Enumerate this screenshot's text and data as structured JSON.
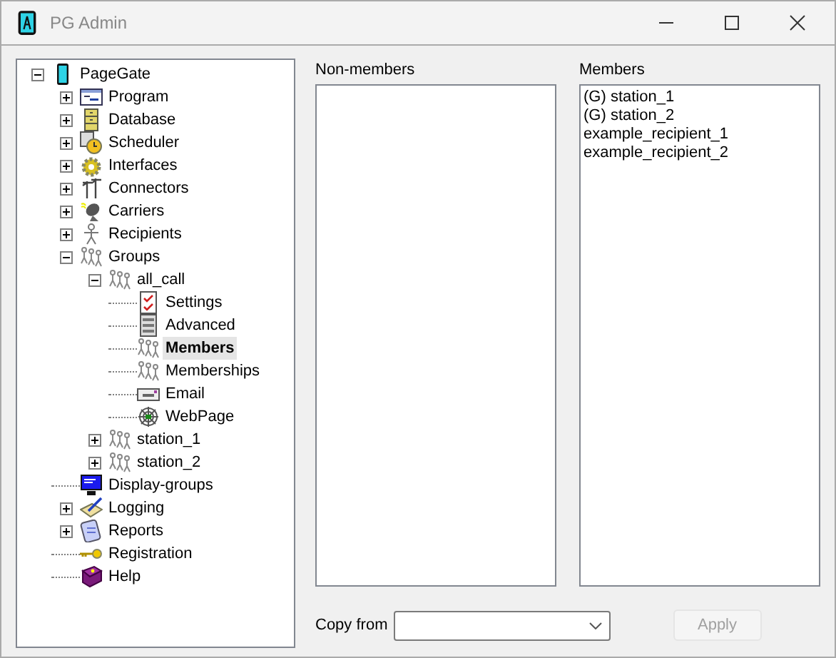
{
  "window": {
    "title": "PG Admin"
  },
  "tree": [
    {
      "label": "PageGate",
      "kind": "phone",
      "expanded": true,
      "selected": false,
      "children": [
        {
          "label": "Program",
          "kind": "program",
          "expanded": false,
          "selected": false
        },
        {
          "label": "Database",
          "kind": "cabinet",
          "expanded": false,
          "selected": false
        },
        {
          "label": "Scheduler",
          "kind": "clock",
          "expanded": false,
          "selected": false
        },
        {
          "label": "Interfaces",
          "kind": "gear",
          "expanded": false,
          "selected": false
        },
        {
          "label": "Connectors",
          "kind": "pole",
          "expanded": false,
          "selected": false
        },
        {
          "label": "Carriers",
          "kind": "dish",
          "expanded": false,
          "selected": false
        },
        {
          "label": "Recipients",
          "kind": "person",
          "expanded": false,
          "selected": false
        },
        {
          "label": "Groups",
          "kind": "people",
          "expanded": true,
          "selected": false,
          "children": [
            {
              "label": "all_call",
              "kind": "people",
              "expanded": true,
              "selected": false,
              "children": [
                {
                  "label": "Settings",
                  "kind": "checklist",
                  "selected": false
                },
                {
                  "label": "Advanced",
                  "kind": "list",
                  "selected": false
                },
                {
                  "label": "Members",
                  "kind": "people",
                  "selected": true
                },
                {
                  "label": "Memberships",
                  "kind": "people",
                  "selected": false
                },
                {
                  "label": "Email",
                  "kind": "envelope",
                  "selected": false
                },
                {
                  "label": "WebPage",
                  "kind": "web",
                  "selected": false
                }
              ]
            },
            {
              "label": "station_1",
              "kind": "people",
              "expanded": false,
              "selected": false
            },
            {
              "label": "station_2",
              "kind": "people",
              "expanded": false,
              "selected": false
            }
          ]
        },
        {
          "label": "Display-groups",
          "kind": "monitor",
          "selected": false
        },
        {
          "label": "Logging",
          "kind": "pen",
          "expanded": false,
          "selected": false
        },
        {
          "label": "Reports",
          "kind": "report",
          "expanded": false,
          "selected": false
        },
        {
          "label": "Registration",
          "kind": "key",
          "selected": false
        },
        {
          "label": "Help",
          "kind": "book",
          "selected": false
        }
      ]
    }
  ],
  "non_members": {
    "label": "Non-members"
  },
  "members": {
    "label": "Members",
    "items": [
      "(G) station_1",
      "(G) station_2",
      "example_recipient_1",
      "example_recipient_2"
    ]
  },
  "copy_from": {
    "label": "Copy from"
  },
  "apply_button": {
    "label": "Apply",
    "disabled": true
  }
}
